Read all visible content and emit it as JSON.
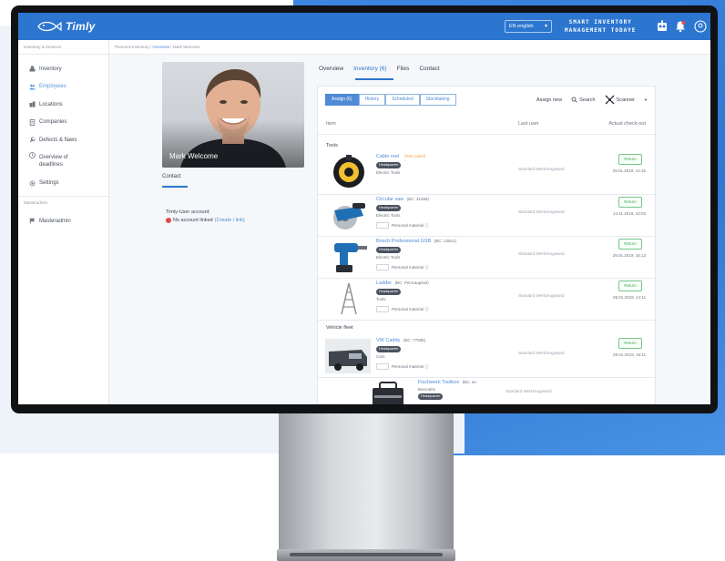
{
  "app": {
    "logo_text": "Timly",
    "language": "EN english",
    "slogan_line1": "SMART INVENTORY",
    "slogan_line2": "MANAGEMENT TODAYE"
  },
  "sidebar": {
    "header": "Inventory & Services",
    "items": [
      {
        "label": "Inventory",
        "icon": "boxes-icon"
      },
      {
        "label": "Employees",
        "icon": "users-icon",
        "active": true
      },
      {
        "label": "Locations",
        "icon": "buildings-icon"
      },
      {
        "label": "Companies",
        "icon": "document-icon"
      },
      {
        "label": "Defects & flaws",
        "icon": "wrench-icon"
      },
      {
        "label_line1": "Overview of",
        "label_line2": "deadlines",
        "icon": "clock-icon"
      },
      {
        "label": "Settings",
        "icon": "gear-icon"
      }
    ],
    "sub_header": "Masteradmin",
    "masteradmin_item": "Masteradmin"
  },
  "breadcrumb": {
    "root": "Personal Inventory",
    "sep": "/",
    "mid": "Overview",
    "current": "Mark Welcome"
  },
  "profile": {
    "name": "Mark Welcome",
    "contact_tab": "Contact",
    "account_title": "Timly-User account:",
    "account_status": "No account linked",
    "account_link": "(Create / link)"
  },
  "tabs": {
    "overview": "Overview",
    "inventory": "Inventory (6)",
    "files": "Files",
    "contact": "Contact"
  },
  "inventory": {
    "subtabs": [
      "Assign (6)",
      "History",
      "Scheduled",
      "Stocktaking"
    ],
    "toolbar": {
      "assign_new": "Assign new",
      "search": "Search",
      "scanner": "Scanner"
    },
    "columns": {
      "item": "Item",
      "last_user": "Last user",
      "actual_checkout": "Actual check-out"
    },
    "groups": {
      "tools": "Tools",
      "vehicle_fleet": "Vehicle fleet"
    },
    "hq_label": "Headquarter",
    "personal_material": "Personal material ⓘ",
    "return_label": "Return",
    "rows": [
      {
        "name": "Cable reel",
        "extra": "",
        "tag": "(Test Label)",
        "category": "Electric Tools",
        "last_user": "Standard Werkzeugwand",
        "checkout": "29.01.2019, 14:15",
        "pm": false
      },
      {
        "name": "Circular saw",
        "extra": "(BC: 31469)",
        "tag": "",
        "category": "Electric Tools",
        "last_user": "Standard Werkzeugwand",
        "checkout": "14.11.2019, 10:03",
        "pm": true
      },
      {
        "name": "Bosch Professional GSB",
        "extra": "(BC: 13541)",
        "tag": "",
        "category": "Electric Tools",
        "last_user": "Standard Werkzeugwand",
        "checkout": "29.01.2019, 16:13",
        "pm": true
      },
      {
        "name": "Ladder",
        "extra": "(BC: Pet.Kaupisel)",
        "tag": "",
        "category": "Tools",
        "last_user": "Standard Werkzeugwand",
        "checkout": "29.01.2019, 14:11",
        "pm": true
      },
      {
        "name": "VW Caddy",
        "extra": "(BC: 77586)",
        "tag": "",
        "category": "Cars",
        "last_user": "Standard Werkzeugwand",
        "checkout": "29.01.2019, 16:11",
        "pm": true
      },
      {
        "name": "Fischwerk Toolbox",
        "extra": "(BC: 4u",
        "tag": "",
        "category": "Barcodes",
        "last_user": "Standard Werkzeugwand",
        "checkout": "",
        "pm": false
      }
    ]
  },
  "colors": {
    "primary": "#2c76cf",
    "link": "#4f8ad6",
    "return_green": "#4aa85d",
    "badge_dark": "#4b5260",
    "warning_orange": "#f1a23c"
  }
}
